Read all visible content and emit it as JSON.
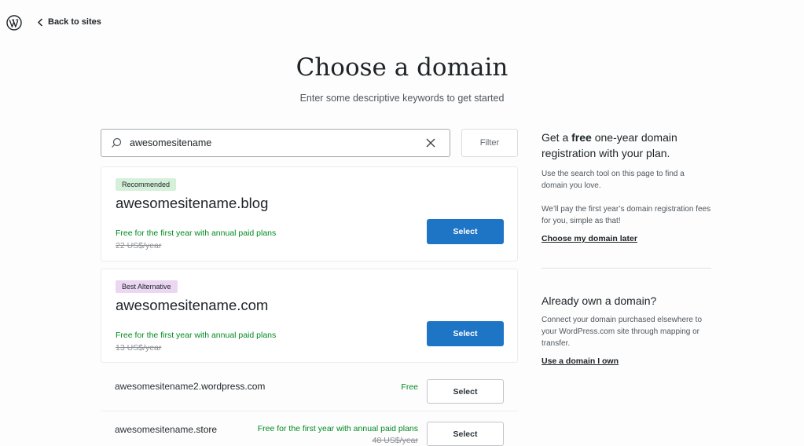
{
  "header": {
    "logo_icon": "wordpress-logo-icon",
    "back_label": "Back to sites"
  },
  "main": {
    "title": "Choose a domain",
    "subtitle": "Enter some descriptive keywords to get started"
  },
  "search": {
    "value": "awesomesitename",
    "placeholder": "",
    "filter_label": "Filter"
  },
  "featured": [
    {
      "badge": "Recommended",
      "domain": "awesomesitename.blog",
      "note": "Free for the first year with annual paid plans",
      "original_price": "22 US$/year",
      "select_label": "Select"
    },
    {
      "badge": "Best Alternative",
      "domain": "awesomesitename.com",
      "note": "Free for the first year with annual paid plans",
      "original_price": "13 US$/year",
      "select_label": "Select"
    }
  ],
  "results": [
    {
      "name": "awesomesitename2",
      "tld": ".wordpress.com",
      "price": "Free",
      "select_label": "Select"
    },
    {
      "name": "awesomesitename",
      "tld": ".store",
      "note": "Free for the first year with annual paid plans",
      "original_price": "48 US$/year",
      "select_label": "Select"
    }
  ],
  "sidebar": {
    "promo_prefix": "Get a ",
    "promo_bold": "free",
    "promo_suffix": " one-year domain registration with your plan.",
    "promo_text_1": "Use the search tool on this page to find a domain you love.",
    "promo_text_2": "We’ll pay the first year’s domain registration fees for you, simple as that!",
    "choose_later": "Choose my domain later",
    "own_heading": "Already own a domain?",
    "own_text": "Connect your domain purchased elsewhere to your WordPress.com site through mapping or transfer.",
    "own_link": "Use a domain I own"
  },
  "colors": {
    "accent": "#1e75c6",
    "free_green": "#008a20",
    "recommended_badge": "#d4f0d9",
    "alternative_badge": "#ebd7f2"
  }
}
